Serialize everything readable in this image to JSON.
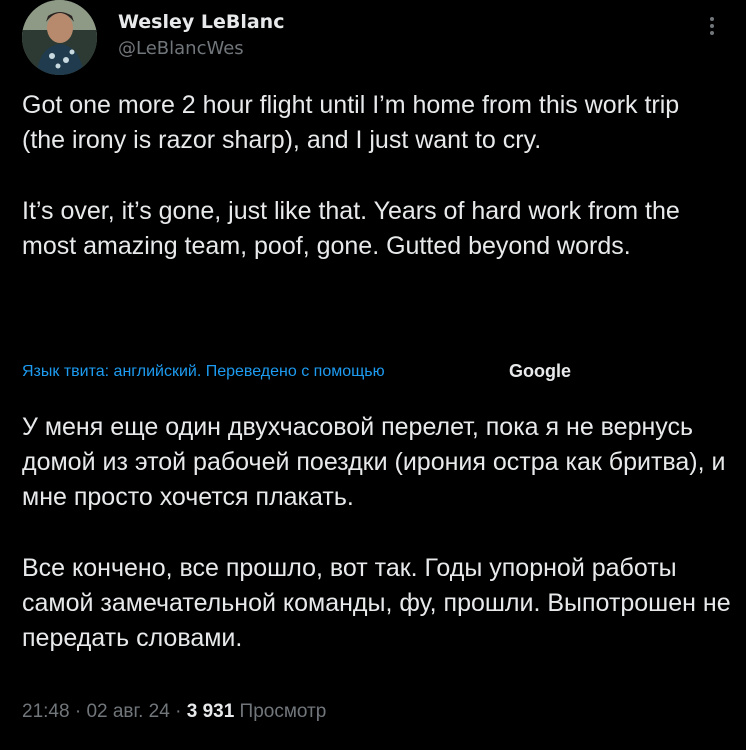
{
  "author": {
    "name": "Wesley LeBlanc",
    "handle": "@LeBlancWes"
  },
  "tweet": {
    "paragraph1": "Got one more 2 hour flight until I’m home from this work trip (the irony is razor sharp), and I just want to cry.",
    "paragraph2": "It’s over, it’s gone, just like that. Years of hard work from the most amazing team, poof, gone. Gutted beyond words."
  },
  "translation": {
    "notice": "Язык твита: английский. Переведено с помощью",
    "provider": "Google",
    "paragraph1": "У меня еще один двухчасовой перелет, пока я не вернусь домой из этой рабочей поездки (ирония остра как бритва), и мне просто хочется плакать.",
    "paragraph2": "Все кончено, все прошло, вот так. Годы упорной работы самой замечательной команды, фу, прошли. Выпотрошен не передать словами."
  },
  "meta": {
    "time": "21:48",
    "sep1": " · ",
    "date": "02 авг. 24",
    "sep2": " · ",
    "views": "3 931",
    "views_label": " Просмотр"
  },
  "icons": {
    "more": "more-vertical-icon"
  }
}
